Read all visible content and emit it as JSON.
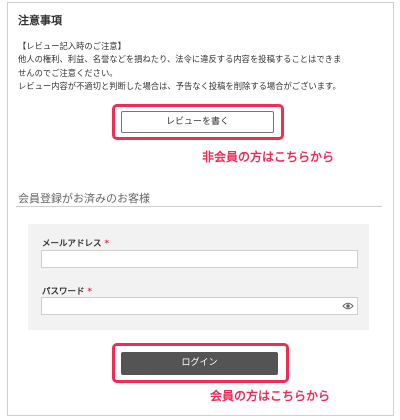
{
  "notice": {
    "title": "注意事項",
    "lines": [
      "【レビュー記入時のご注意】",
      "他人の権利、利益、名誉などを損ねたり、法令に違反する内容を投稿することはできま",
      "せんのでご注意ください。",
      "レビュー内容が不適切と判断した場合は、予告なく投稿を削除する場合がございます。"
    ],
    "review_button": "レビューを書く"
  },
  "annotations": {
    "non_member": "非会員の方はこちらから",
    "member": "会員の方はこちらから",
    "highlight_color": "#ee2d55"
  },
  "login": {
    "header": "会員登録がお済みのお客様",
    "email_label": "メールアドレス",
    "password_label": "パスワード",
    "required_mark": "*",
    "email_value": "",
    "password_value": "",
    "submit_label": "ログイン",
    "password_toggle_icon": "eye-icon"
  }
}
